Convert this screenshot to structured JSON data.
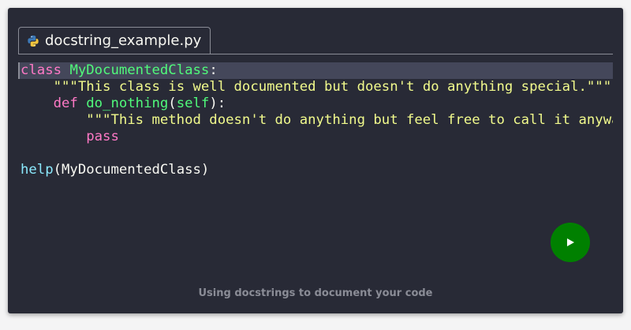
{
  "tab": {
    "filename": "docstring_example.py",
    "icon": "python-icon"
  },
  "code": {
    "line1": {
      "kw": "class",
      "name": "MyDocumentedClass",
      "punct": ":"
    },
    "line2": {
      "indent": "    ",
      "str": "\"\"\"This class is well documented but doesn't do anything special.\"\"\""
    },
    "line3": {
      "indent": "    ",
      "kw": "def",
      "name": "do_nothing",
      "open": "(",
      "param": "self",
      "close": "):"
    },
    "line4": {
      "indent": "        ",
      "str": "\"\"\"This method doesn't do anything but feel free to call it anyway.\"\"\""
    },
    "line5": {
      "indent": "        ",
      "kw": "pass"
    },
    "line6": {},
    "line7": {
      "builtin": "help",
      "args": "(MyDocumentedClass)"
    }
  },
  "run_button": {
    "icon": "play-icon",
    "color": "#008000"
  },
  "caption": "Using docstrings to document your code",
  "colors": {
    "background": "#282a36",
    "keyword": "#ff79c6",
    "string": "#f1fa8c",
    "name": "#50fa7b",
    "builtin": "#8be9fd"
  }
}
